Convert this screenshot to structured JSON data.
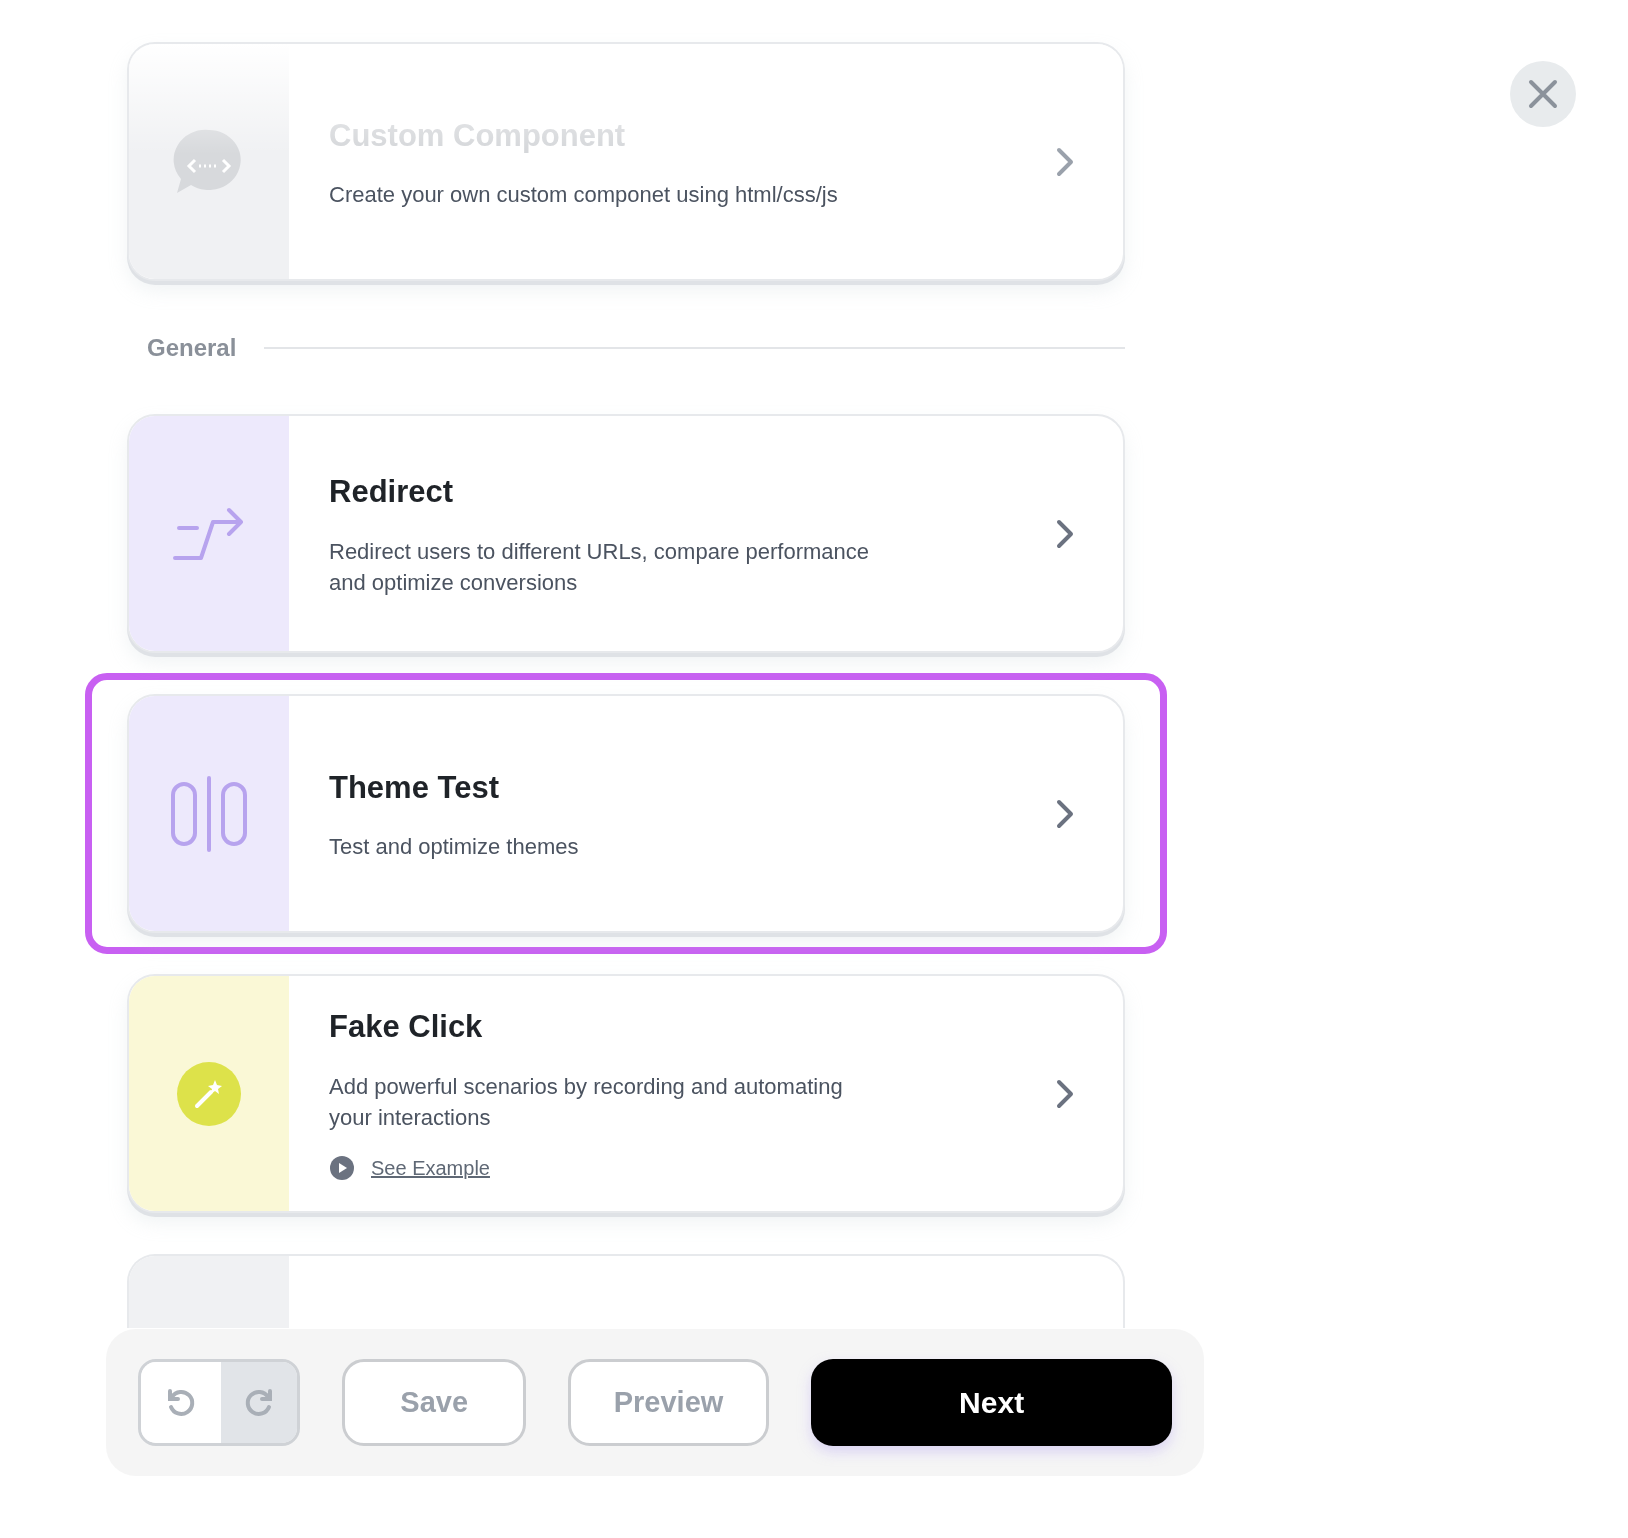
{
  "cards": [
    {
      "kind": "code",
      "title": "Custom Component",
      "description": "Create your own custom componet using html/css/js",
      "faded": true,
      "selected": false,
      "color": "#f0f1f3"
    },
    {
      "kind": "section",
      "label": "General"
    },
    {
      "kind": "redirect",
      "title": "Redirect",
      "description": "Redirect users to different URLs, compare performance and optimize conversions",
      "faded": false,
      "selected": false,
      "color": "#ede9fc"
    },
    {
      "kind": "theme",
      "title": "Theme Test",
      "description": "Test and optimize themes",
      "faded": false,
      "selected": true,
      "color": "#ede9fc"
    },
    {
      "kind": "wand",
      "title": "Fake Click",
      "description": "Add powerful scenarios by recording and automating your interactions",
      "link": "See Example",
      "faded": false,
      "selected": false,
      "color": "#faf8d6"
    },
    {
      "kind": "hidden",
      "faded": false,
      "selected": false,
      "color": "#f0f1f3"
    }
  ],
  "toolbar": {
    "undo_disabled": false,
    "redo_disabled": true,
    "buttons": [
      {
        "label": "Save",
        "kind": "outline"
      },
      {
        "label": "Preview",
        "kind": "outline"
      },
      {
        "label": "Next",
        "kind": "primary"
      }
    ]
  }
}
